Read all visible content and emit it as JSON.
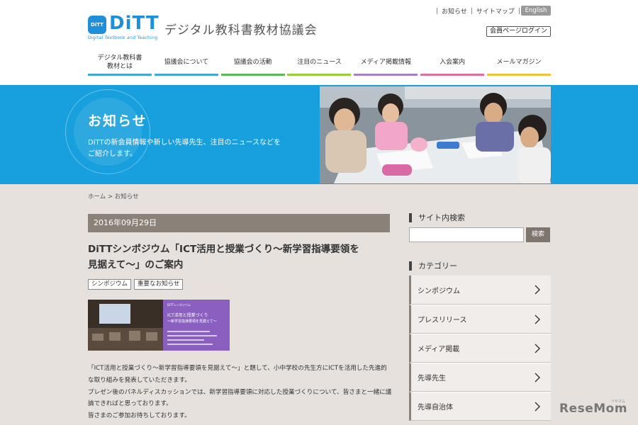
{
  "header": {
    "logo_text": "DiTT",
    "logo_mark": "DiTT",
    "logo_sub": "Digital Textbook and Teaching",
    "org_name": "デジタル教科書教材協議会",
    "util_links": [
      "お知らせ",
      "サイトマップ"
    ],
    "lang_label": "English",
    "member_login": "会員ページログイン"
  },
  "nav": {
    "items": [
      {
        "line1": "デジタル教科書",
        "line2": "教材とは"
      },
      {
        "line1": "協議会について",
        "line2": ""
      },
      {
        "line1": "協議会の活動",
        "line2": ""
      },
      {
        "line1": "注目のニュース",
        "line2": ""
      },
      {
        "line1": "メディア掲載情報",
        "line2": ""
      },
      {
        "line1": "入会案内",
        "line2": ""
      },
      {
        "line1": "メールマガジン",
        "line2": ""
      }
    ]
  },
  "hero": {
    "title": "お知らせ",
    "desc_line1": "DiTTの新会員情報や新しい先導先生、注目のニュースなどを",
    "desc_line2": "ご紹介します。"
  },
  "breadcrumb": {
    "home": "ホーム",
    "sep": ">",
    "current": "お知らせ"
  },
  "article": {
    "date": "2016年09月29日",
    "title_line1": "DiTTシンポジウム「ICT活用と授業づくり～新学習指導要領を",
    "title_line2": "見据えて～」のご案内",
    "tags": [
      "シンポジウム",
      "重要なお知らせ"
    ],
    "thumb_caption_small": "DiTTシンポジウム",
    "thumb_title1": "ICT活用と授業づくり",
    "thumb_title2": "～新学習指導要領を見据えて～",
    "body": [
      "「ICT活用と授業づくり～新学習指導要領を見据えて～」と題して、小中学校の先生方にICTを活用した先進的",
      "な取り組みを発表していただきます。",
      "プレゼン後のパネルディスカッションでは、新学習指導要領に対応した授業づくりについて、皆さまと一緒に議",
      "論できればと思っております。",
      "皆さまのご参加お待ちしております。"
    ]
  },
  "sidebar": {
    "search_heading": "サイト内検索",
    "search_placeholder": "",
    "search_button": "検索",
    "category_heading": "カテゴリー",
    "categories": [
      "シンポジウム",
      "プレスリリース",
      "メディア掲載",
      "先導先生",
      "先導自治体"
    ]
  },
  "watermark": {
    "text": "ReseMom",
    "small": "リセマム"
  },
  "colors": {
    "brand_blue": "#1e8fd8",
    "hero_blue": "#17a0dd",
    "content_bg": "#e6e1dd",
    "date_bar": "#8a8178"
  }
}
